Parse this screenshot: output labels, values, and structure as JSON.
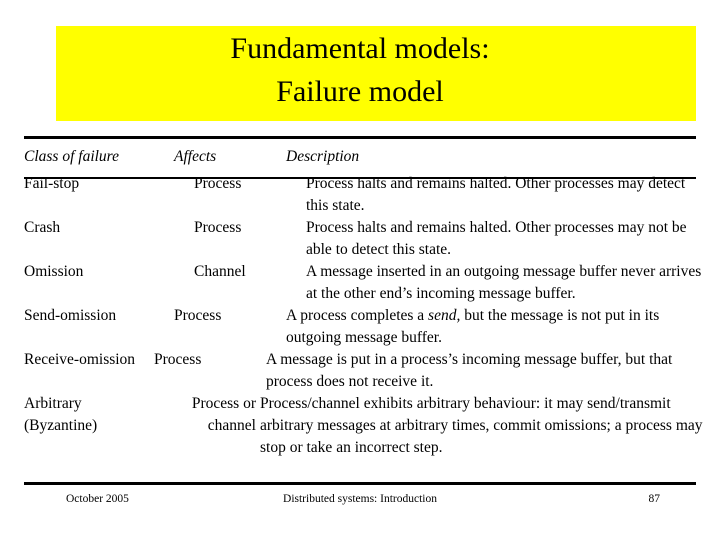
{
  "slide": {
    "title_line1": "Fundamental models:",
    "title_line2": "Failure model",
    "title_band_color": "#ffff00"
  },
  "table": {
    "headers": {
      "class": "Class of failure",
      "affects": "Affects",
      "description": "Description"
    },
    "rows": [
      {
        "class": "Fail-stop",
        "affects": "Process",
        "description": "Process halts and remains halted. Other processes may detect this state."
      },
      {
        "class": "Crash",
        "affects": "Process",
        "description": "Process halts and remains halted. Other processes may not be able to detect this state."
      },
      {
        "class": "Omission",
        "affects": "Channel",
        "description": "A message inserted in an outgoing message buffer never arrives at the other end’s incoming message buffer."
      },
      {
        "class": "Send-omission",
        "affects": "Process",
        "description_pre": "A process completes a ",
        "description_em": "send,",
        "description_post": " but the message is not put in its outgoing message buffer."
      },
      {
        "class": "Receive-omission",
        "affects": "Process",
        "description": "A message is put in a process’s incoming message buffer, but that process does not receive it."
      },
      {
        "class": "Arbitrary",
        "class_line2": "(Byzantine)",
        "affects": "Process or",
        "affects_line2": "channel",
        "description": "Process/channel exhibits arbitrary behaviour: it may send/transmit arbitrary messages at arbitrary times, commit omissions; a process may stop or take an incorrect step."
      }
    ]
  },
  "footer": {
    "date": "October 2005",
    "center": "Distributed systems: Introduction",
    "page": "87"
  }
}
